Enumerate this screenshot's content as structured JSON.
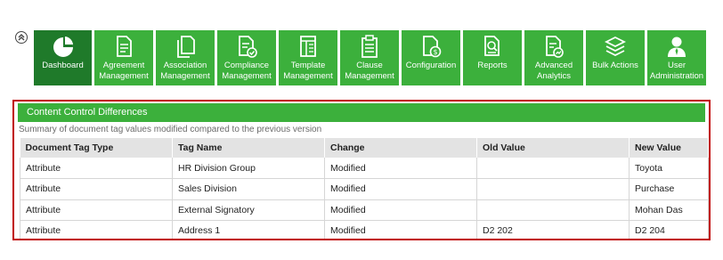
{
  "nav": {
    "items": [
      {
        "label": "Dashboard",
        "icon": "pie-chart-icon",
        "active": true
      },
      {
        "label": "Agreement\nManagement",
        "icon": "documents-icon"
      },
      {
        "label": "Association\nManagement",
        "icon": "copy-documents-icon"
      },
      {
        "label": "Compliance\nManagement",
        "icon": "document-check-icon"
      },
      {
        "label": "Template\nManagement",
        "icon": "template-icon"
      },
      {
        "label": "Clause\nManagement",
        "icon": "clipboard-icon"
      },
      {
        "label": "Configuration",
        "icon": "document-settings-icon"
      },
      {
        "label": "Reports",
        "icon": "document-search-icon"
      },
      {
        "label": "Advanced\nAnalytics",
        "icon": "document-chart-icon"
      },
      {
        "label": "Bulk Actions",
        "icon": "layers-icon"
      },
      {
        "label": "User\nAdministration",
        "icon": "user-icon"
      }
    ]
  },
  "panel": {
    "title": "Content Control Differences",
    "subtitle": "Summary of document tag values modified compared to the previous version"
  },
  "table": {
    "headers": [
      "Document Tag Type",
      "Tag Name",
      "Change",
      "Old Value",
      "New Value"
    ],
    "rows": [
      [
        "Attribute",
        "HR Division Group",
        "Modified",
        "",
        "Toyota"
      ],
      [
        "Attribute",
        "Sales Division",
        "Modified",
        "",
        "Purchase"
      ],
      [
        "Attribute",
        "External Signatory",
        "Modified",
        "",
        "Mohan Das"
      ],
      [
        "Attribute",
        "Address 1",
        "Modified",
        "D2 202",
        "D2 204"
      ]
    ]
  },
  "colors": {
    "nav_green": "#3cb03c",
    "nav_active": "#1f7a2a",
    "panel_border": "#c00000",
    "header_bg": "#e3e3e3"
  }
}
